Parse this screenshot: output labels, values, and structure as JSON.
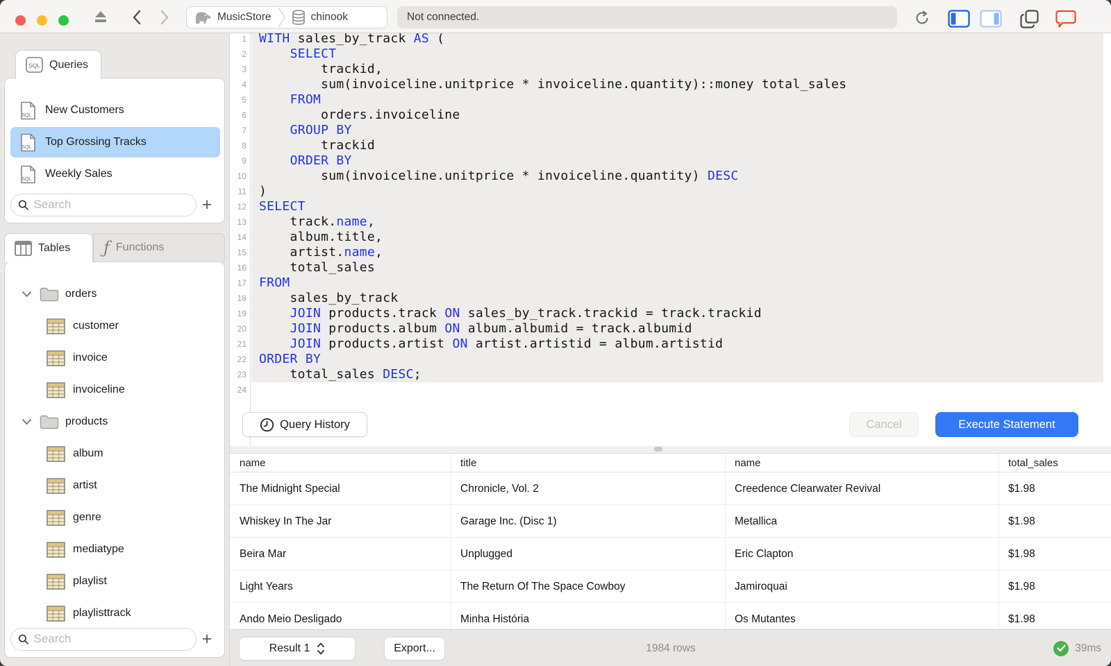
{
  "titlebar": {
    "status": "Not connected.",
    "breadcrumb": {
      "server": "MusicStore",
      "database": "chinook"
    }
  },
  "icons": {
    "sql_badge": "SQL",
    "functions": "ƒ",
    "add": "+"
  },
  "sidebar": {
    "queries": {
      "tab_label": "Queries",
      "items": [
        {
          "label": "New Customers",
          "selected": false
        },
        {
          "label": "Top Grossing Tracks",
          "selected": true
        },
        {
          "label": "Weekly Sales",
          "selected": false
        }
      ],
      "search_placeholder": "Search"
    },
    "schema": {
      "tabs": [
        {
          "label": "Tables",
          "active": true
        },
        {
          "label": "Functions",
          "active": false
        }
      ],
      "tree": [
        {
          "type": "folder",
          "label": "orders",
          "expanded": true,
          "children": [
            "customer",
            "invoice",
            "invoiceline"
          ]
        },
        {
          "type": "folder",
          "label": "products",
          "expanded": true,
          "children": [
            "album",
            "artist",
            "genre",
            "mediatype",
            "playlist",
            "playlisttrack"
          ]
        }
      ],
      "search_placeholder": "Search"
    }
  },
  "editor": {
    "highlight_through_line": 23,
    "lines": [
      {
        "n": 1,
        "seg": [
          [
            "WITH",
            1
          ],
          [
            " sales_by_track ",
            0
          ],
          [
            "AS",
            1
          ],
          [
            " (",
            0
          ]
        ]
      },
      {
        "n": 2,
        "seg": [
          [
            "    ",
            0
          ],
          [
            "SELECT",
            1
          ]
        ]
      },
      {
        "n": 3,
        "seg": [
          [
            "        trackid,",
            0
          ]
        ]
      },
      {
        "n": 4,
        "seg": [
          [
            "        sum(invoiceline.unitprice * invoiceline.quantity)::money total_sales",
            0
          ]
        ]
      },
      {
        "n": 5,
        "seg": [
          [
            "    ",
            0
          ],
          [
            "FROM",
            1
          ]
        ]
      },
      {
        "n": 6,
        "seg": [
          [
            "        orders.invoiceline",
            0
          ]
        ]
      },
      {
        "n": 7,
        "seg": [
          [
            "    ",
            0
          ],
          [
            "GROUP BY",
            1
          ]
        ]
      },
      {
        "n": 8,
        "seg": [
          [
            "        trackid",
            0
          ]
        ]
      },
      {
        "n": 9,
        "seg": [
          [
            "    ",
            0
          ],
          [
            "ORDER BY",
            1
          ]
        ]
      },
      {
        "n": 10,
        "seg": [
          [
            "        sum(invoiceline.unitprice * invoiceline.quantity) ",
            0
          ],
          [
            "DESC",
            1
          ]
        ]
      },
      {
        "n": 11,
        "seg": [
          [
            ")",
            0
          ]
        ]
      },
      {
        "n": 12,
        "seg": [
          [
            "SELECT",
            1
          ]
        ]
      },
      {
        "n": 13,
        "seg": [
          [
            "    track.",
            0
          ],
          [
            "name",
            1
          ],
          [
            ",",
            0
          ]
        ]
      },
      {
        "n": 14,
        "seg": [
          [
            "    album.title,",
            0
          ]
        ]
      },
      {
        "n": 15,
        "seg": [
          [
            "    artist.",
            0
          ],
          [
            "name",
            1
          ],
          [
            ",",
            0
          ]
        ]
      },
      {
        "n": 16,
        "seg": [
          [
            "    total_sales",
            0
          ]
        ]
      },
      {
        "n": 17,
        "seg": [
          [
            "FROM",
            1
          ]
        ]
      },
      {
        "n": 18,
        "seg": [
          [
            "    sales_by_track",
            0
          ]
        ]
      },
      {
        "n": 19,
        "seg": [
          [
            "    ",
            0
          ],
          [
            "JOIN",
            1
          ],
          [
            " products.track ",
            0
          ],
          [
            "ON",
            1
          ],
          [
            " sales_by_track.trackid = track.trackid",
            0
          ]
        ]
      },
      {
        "n": 20,
        "seg": [
          [
            "    ",
            0
          ],
          [
            "JOIN",
            1
          ],
          [
            " products.album ",
            0
          ],
          [
            "ON",
            1
          ],
          [
            " album.albumid = track.albumid",
            0
          ]
        ]
      },
      {
        "n": 21,
        "seg": [
          [
            "    ",
            0
          ],
          [
            "JOIN",
            1
          ],
          [
            " products.artist ",
            0
          ],
          [
            "ON",
            1
          ],
          [
            " artist.artistid = album.artistid",
            0
          ]
        ]
      },
      {
        "n": 22,
        "seg": [
          [
            "ORDER BY",
            1
          ]
        ]
      },
      {
        "n": 23,
        "seg": [
          [
            "    total_sales ",
            0
          ],
          [
            "DESC",
            1
          ],
          [
            ";",
            0
          ]
        ]
      },
      {
        "n": 24,
        "seg": []
      }
    ]
  },
  "actions": {
    "query_history": "Query History",
    "cancel": "Cancel",
    "execute": "Execute Statement"
  },
  "results": {
    "columns": [
      "name",
      "title",
      "name",
      "total_sales"
    ],
    "column_offsets": [
      0,
      318,
      713,
      1107
    ],
    "rows": [
      [
        "The Midnight Special",
        "Chronicle, Vol. 2",
        "Creedence Clearwater Revival",
        "$1.98"
      ],
      [
        "Whiskey In The Jar",
        "Garage Inc. (Disc 1)",
        "Metallica",
        "$1.98"
      ],
      [
        "Beira Mar",
        "Unplugged",
        "Eric Clapton",
        "$1.98"
      ],
      [
        "Light Years",
        "The Return Of The Space Cowboy",
        "Jamiroquai",
        "$1.98"
      ],
      [
        "Ando Meio Desligado",
        "Minha História",
        "Os Mutantes",
        "$1.98"
      ]
    ]
  },
  "statusbar": {
    "result_selector": "Result 1",
    "export_label": "Export...",
    "row_count": "1984 rows",
    "duration": "39ms"
  },
  "colors": {
    "accent_blue": "#3478f6",
    "keyword_blue": "#2531e8",
    "selection_blue": "#b3d7fb",
    "success_green": "#45b449",
    "bubble_orange": "#e8502a"
  }
}
